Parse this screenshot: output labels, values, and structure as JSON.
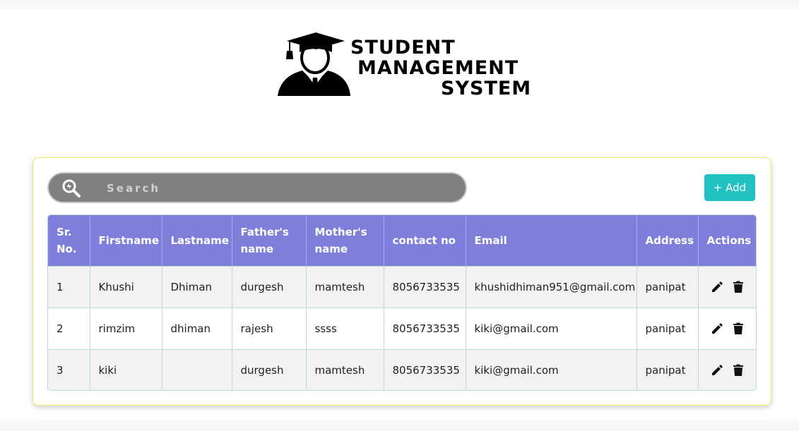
{
  "logo": {
    "line1": "STUDENT",
    "line2": "MANAGEMENT",
    "line3": "SYSTEM"
  },
  "search": {
    "placeholder": "Search",
    "icon": "search-icon"
  },
  "toolbar": {
    "add_label": "+ Add"
  },
  "table": {
    "headers": {
      "sr": "Sr. No.",
      "firstname": "Firstname",
      "lastname": "Lastname",
      "father": "Father's name",
      "mother": "Mother's name",
      "contact": "contact no",
      "email": "Email",
      "address": "Address",
      "actions": "Actions"
    },
    "rows": [
      {
        "sr": "1",
        "firstname": "Khushi",
        "lastname": "Dhiman",
        "father": "durgesh",
        "mother": "mamtesh",
        "contact": "8056733535",
        "email": "khushidhiman951@gmail.com",
        "address": "panipat"
      },
      {
        "sr": "2",
        "firstname": "rimzim",
        "lastname": "dhiman",
        "father": "rajesh",
        "mother": "ssss",
        "contact": "8056733535",
        "email": "kiki@gmail.com",
        "address": "panipat"
      },
      {
        "sr": "3",
        "firstname": "kiki",
        "lastname": "",
        "father": "durgesh",
        "mother": "mamtesh",
        "contact": "8056733535",
        "email": "kiki@gmail.com",
        "address": "panipat"
      }
    ]
  },
  "colors": {
    "header_bg": "#7f7edb",
    "add_button": "#21c1c1",
    "card_border": "#f1e86a",
    "search_bg": "#808080"
  }
}
